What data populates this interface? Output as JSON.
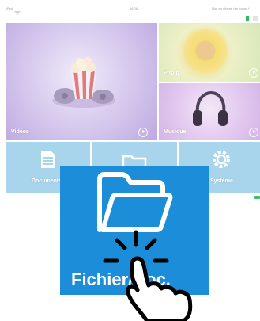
{
  "status_bar": {
    "left": "iPad",
    "time": "16:06",
    "right": "Non en charge (en cours ⚡"
  },
  "tiles": {
    "videos": {
      "label": "Vidéos"
    },
    "photo": {
      "label": "Photo"
    },
    "music": {
      "label": "Musique"
    },
    "documents": {
      "label": "Documents"
    },
    "files": {
      "label": "Fichier/Doc."
    },
    "system": {
      "label": "Système"
    }
  },
  "featured": {
    "label": "Fichier/Doc.",
    "icon": "folder-icon"
  },
  "colors": {
    "tile_blue": "#a9d5ec",
    "featured_blue": "#1c8ed9",
    "accent_green": "#2ebd5c"
  }
}
